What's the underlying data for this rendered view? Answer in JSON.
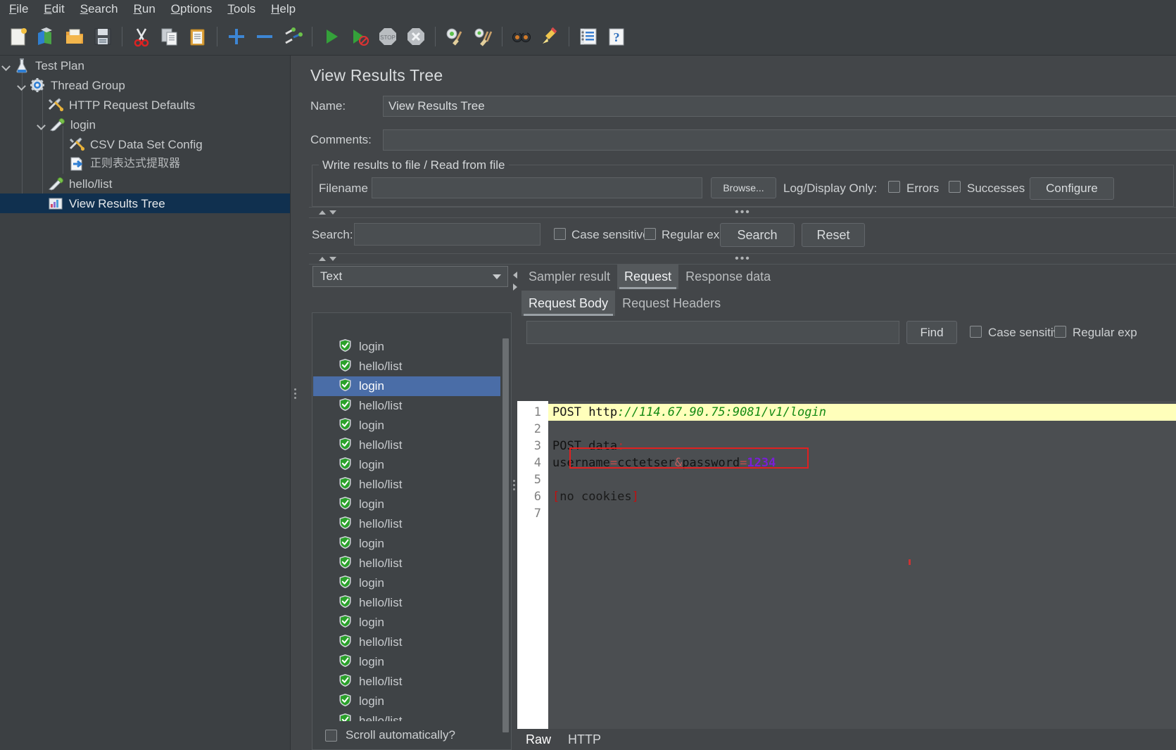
{
  "menubar": {
    "items": [
      {
        "label": "File",
        "mnemonic": "F"
      },
      {
        "label": "Edit",
        "mnemonic": "E"
      },
      {
        "label": "Search",
        "mnemonic": "S"
      },
      {
        "label": "Run",
        "mnemonic": "R"
      },
      {
        "label": "Options",
        "mnemonic": "O"
      },
      {
        "label": "Tools",
        "mnemonic": "T"
      },
      {
        "label": "Help",
        "mnemonic": "H"
      }
    ]
  },
  "toolbar": {
    "buttons": [
      {
        "name": "new-icon",
        "tip": "New"
      },
      {
        "name": "templates-icon",
        "tip": "Templates"
      },
      {
        "name": "open-icon",
        "tip": "Open"
      },
      {
        "name": "save-icon",
        "tip": "Save Test Plan"
      },
      {
        "name": "cut-icon",
        "tip": "Cut"
      },
      {
        "name": "copy-icon",
        "tip": "Copy"
      },
      {
        "name": "paste-icon",
        "tip": "Paste"
      },
      {
        "name": "expand-all-icon",
        "tip": "Expand All"
      },
      {
        "name": "collapse-all-icon",
        "tip": "Collapse All"
      },
      {
        "name": "toggle-icon",
        "tip": "Toggle"
      },
      {
        "name": "start-icon",
        "tip": "Start"
      },
      {
        "name": "start-no-pauses-icon",
        "tip": "Start no pauses"
      },
      {
        "name": "stop-icon",
        "tip": "Stop"
      },
      {
        "name": "shutdown-icon",
        "tip": "Shutdown"
      },
      {
        "name": "clear-icon",
        "tip": "Clear"
      },
      {
        "name": "clear-all-icon",
        "tip": "Clear All"
      },
      {
        "name": "search-icon",
        "tip": "Search"
      },
      {
        "name": "search-reset-icon",
        "tip": "Reset Search"
      },
      {
        "name": "function-helper-icon",
        "tip": "Function Helper Dialog"
      },
      {
        "name": "help-icon",
        "tip": "Help"
      }
    ]
  },
  "tree": {
    "nodes": [
      {
        "label": "Test Plan",
        "icon": "test-plan-icon",
        "depth": 0,
        "twisty": "open",
        "selected": false
      },
      {
        "label": "Thread Group",
        "icon": "thread-group-icon",
        "depth": 1,
        "twisty": "open",
        "selected": false
      },
      {
        "label": "HTTP Request Defaults",
        "icon": "config-element-icon",
        "depth": 2,
        "twisty": "",
        "selected": false
      },
      {
        "label": "login",
        "icon": "http-sampler-icon",
        "depth": 2,
        "twisty": "open",
        "selected": false
      },
      {
        "label": "CSV Data Set Config",
        "icon": "config-element-icon",
        "depth": 3,
        "twisty": "",
        "selected": false
      },
      {
        "label": "正则表达式提取器",
        "icon": "post-processor-icon",
        "depth": 3,
        "twisty": "",
        "selected": false
      },
      {
        "label": "hello/list",
        "icon": "http-sampler-icon",
        "depth": 2,
        "twisty": "",
        "selected": false
      },
      {
        "label": "View Results Tree",
        "icon": "listener-icon",
        "depth": 2,
        "twisty": "",
        "selected": true
      }
    ]
  },
  "panel": {
    "title": "View Results Tree",
    "name_label": "Name:",
    "name_value": "View Results Tree",
    "comments_label": "Comments:",
    "comments_value": "",
    "file_group_legend": "Write results to file / Read from file",
    "filename_label": "Filename",
    "filename_value": "",
    "browse_label": "Browse...",
    "log_display_label": "Log/Display Only:",
    "errors_label": "Errors",
    "errors_checked": false,
    "successes_label": "Successes",
    "successes_checked": false,
    "configure_label": "Configure"
  },
  "search_bar": {
    "label": "Search:",
    "value": "",
    "case_sensitive_label": "Case sensitive",
    "case_sensitive_checked": false,
    "regular_exp_label": "Regular exp.",
    "regular_exp_checked": false,
    "search_button": "Search",
    "reset_button": "Reset"
  },
  "results": {
    "render_selector": "Text",
    "scroll_automatically_label": "Scroll automatically?",
    "scroll_automatically_checked": false,
    "items": [
      {
        "label": "login",
        "status": "success",
        "selected": false
      },
      {
        "label": "hello/list",
        "status": "success",
        "selected": false
      },
      {
        "label": "login",
        "status": "success",
        "selected": true
      },
      {
        "label": "hello/list",
        "status": "success",
        "selected": false
      },
      {
        "label": "login",
        "status": "success",
        "selected": false
      },
      {
        "label": "hello/list",
        "status": "success",
        "selected": false
      },
      {
        "label": "login",
        "status": "success",
        "selected": false
      },
      {
        "label": "hello/list",
        "status": "success",
        "selected": false
      },
      {
        "label": "login",
        "status": "success",
        "selected": false
      },
      {
        "label": "hello/list",
        "status": "success",
        "selected": false
      },
      {
        "label": "login",
        "status": "success",
        "selected": false
      },
      {
        "label": "hello/list",
        "status": "success",
        "selected": false
      },
      {
        "label": "login",
        "status": "success",
        "selected": false
      },
      {
        "label": "hello/list",
        "status": "success",
        "selected": false
      },
      {
        "label": "login",
        "status": "success",
        "selected": false
      },
      {
        "label": "hello/list",
        "status": "success",
        "selected": false
      },
      {
        "label": "login",
        "status": "success",
        "selected": false
      },
      {
        "label": "hello/list",
        "status": "success",
        "selected": false
      },
      {
        "label": "login",
        "status": "success",
        "selected": false
      },
      {
        "label": "hello/list",
        "status": "success",
        "selected": false
      }
    ]
  },
  "detail_tabs": {
    "primary": [
      {
        "label": "Sampler result",
        "active": false
      },
      {
        "label": "Request",
        "active": true
      },
      {
        "label": "Response data",
        "active": false
      }
    ],
    "secondary": [
      {
        "label": "Request Body",
        "active": true
      },
      {
        "label": "Request Headers",
        "active": false
      }
    ]
  },
  "find_bar": {
    "value": "",
    "find_button": "Find",
    "case_sensitive_label": "Case sensitive",
    "case_sensitive_checked": false,
    "regular_exp_label": "Regular exp",
    "regular_exp_checked": false
  },
  "code": {
    "lines": [
      {
        "num": "1",
        "highlight": true,
        "tokens": [
          {
            "t": "POST ",
            "c": "tok-kw"
          },
          {
            "t": "http",
            "c": "tok-plain"
          },
          {
            "t": "://114.67.90.75:9081/v1/login",
            "c": "tok-url"
          }
        ]
      },
      {
        "num": "2",
        "highlight": false,
        "tokens": []
      },
      {
        "num": "3",
        "highlight": false,
        "tokens": [
          {
            "t": "POST data",
            "c": "tok-plain"
          },
          {
            "t": ":",
            "c": "tok-colon"
          }
        ]
      },
      {
        "num": "4",
        "highlight": false,
        "tokens": [
          {
            "t": "username",
            "c": "tok-plain"
          },
          {
            "t": "=",
            "c": "tok-eq"
          },
          {
            "t": "cctetser",
            "c": "tok-plain"
          },
          {
            "t": "&",
            "c": "tok-amp"
          },
          {
            "t": "password",
            "c": "tok-plain"
          },
          {
            "t": "=",
            "c": "tok-eq"
          },
          {
            "t": "1234",
            "c": "tok-num"
          }
        ]
      },
      {
        "num": "5",
        "highlight": false,
        "tokens": []
      },
      {
        "num": "6",
        "highlight": false,
        "tokens": [
          {
            "t": "[",
            "c": "tok-br"
          },
          {
            "t": "no cookies",
            "c": "tok-cook"
          },
          {
            "t": "]",
            "c": "tok-br"
          }
        ]
      },
      {
        "num": "7",
        "highlight": false,
        "tokens": []
      }
    ],
    "annotation_color": "#e02020"
  },
  "bottom_tabs": [
    {
      "label": "Raw",
      "active": true
    },
    {
      "label": "HTTP",
      "active": false
    }
  ]
}
